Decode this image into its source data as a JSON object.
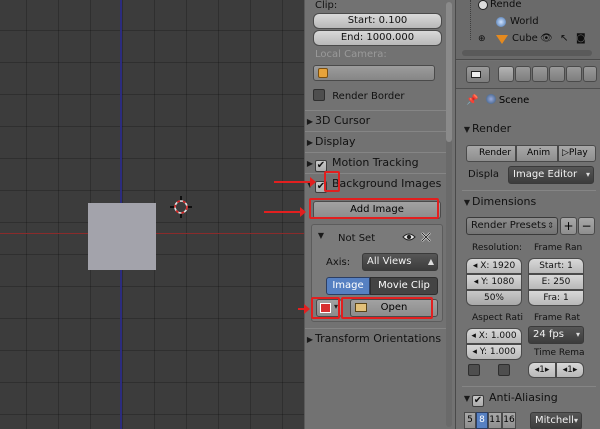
{
  "npanel": {
    "clip_label": "Clip:",
    "clip_start": "Start: 0.100",
    "clip_end": "End: 1000.000",
    "local_camera_label": "Local Camera:",
    "render_border": "Render Border",
    "sections": {
      "cursor3d": "3D Cursor",
      "display": "Display",
      "motion_tracking": "Motion Tracking",
      "background_images": "Background Images",
      "transform_orientations": "Transform Orientations"
    },
    "add_image": "Add Image",
    "bg_image": {
      "name": "Not Set",
      "axis_label": "Axis:",
      "axis_value": "All Views",
      "tab_image": "Image",
      "tab_movie_clip": "Movie Clip",
      "open": "Open"
    }
  },
  "outliner": {
    "items": [
      "Rende",
      "World",
      "Cube"
    ]
  },
  "properties": {
    "context": "Scene",
    "render": {
      "title": "Render",
      "render_btn": "Render",
      "anim_btn": "Anim",
      "play_btn": "Play",
      "display_label": "Displa",
      "display_value": "Image Editor"
    },
    "dimensions": {
      "title": "Dimensions",
      "presets": "Render Presets",
      "resolution_label": "Resolution:",
      "res_x": "1920",
      "res_y": "1080",
      "res_pct": "50%",
      "frame_range_label": "Frame Ran",
      "start": "Start: 1",
      "end": "E: 250",
      "frame_step": "Fra: 1",
      "aspect_label": "Aspect Rati",
      "aspect_x": "1.000",
      "aspect_y": "1.000",
      "frame_rate_label": "Frame Rat",
      "fps": "24 fps",
      "time_remap_label": "Time Rema",
      "remap_old": "1",
      "remap_new": "1"
    },
    "anti_aliasing": {
      "title": "Anti-Aliasing",
      "samples": [
        "5",
        "8",
        "11",
        "16"
      ],
      "filter": "Mitchell-"
    }
  },
  "colors": {
    "highlight": "#e21f1f",
    "active_tab": "#5680c2",
    "grid_bg": "#3c3c3c",
    "panel_bg": "#727272"
  }
}
